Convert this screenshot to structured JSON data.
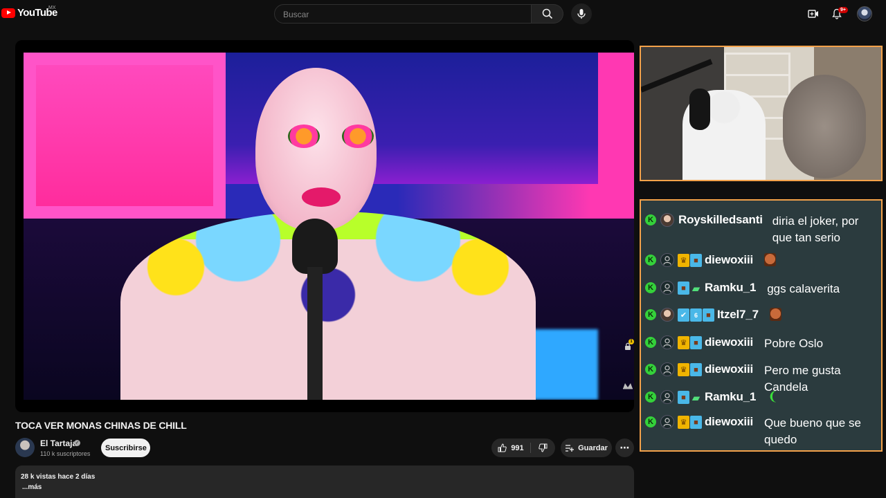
{
  "header": {
    "logo_text": "YouTube",
    "region": "MX",
    "search_placeholder": "Buscar",
    "notifications_count": "9+"
  },
  "player": {
    "controls": [
      "lock-icon",
      "theater-icon"
    ],
    "lock_badge": "1"
  },
  "chat": {
    "messages": [
      {
        "user": "Royskilledsanti",
        "badges": [],
        "text": "diria el joker, por que tan serio"
      },
      {
        "user": "diewoxiii",
        "badges": [
          "crown",
          "pic"
        ],
        "text": "",
        "emote": "face"
      },
      {
        "user": "Ramku_1",
        "badges": [
          "pic",
          "gift"
        ],
        "text": "ggs calaverita"
      },
      {
        "user": "Itzel7_7",
        "badges": [
          "tool",
          "num",
          "pic"
        ],
        "text": "",
        "emote": "face"
      },
      {
        "user": "diewoxiii",
        "badges": [
          "crown",
          "pic"
        ],
        "text": "Pobre Oslo"
      },
      {
        "user": "diewoxiii",
        "badges": [
          "crown",
          "pic"
        ],
        "text": "Pero me gusta Candela"
      },
      {
        "user": "Ramku_1",
        "badges": [
          "pic",
          "gift"
        ],
        "text": "",
        "emote": "pickle"
      },
      {
        "user": "diewoxiii",
        "badges": [
          "crown",
          "pic"
        ],
        "text": "Que bueno que se quedo"
      }
    ]
  },
  "video": {
    "title": "TOCA VER MONAS CHINAS DE CHILL",
    "channel": "El Tartaja",
    "subscribers": "110 k suscriptores",
    "subscribe_label": "Suscribirse",
    "likes": "991",
    "save_label": "Guardar",
    "more_label": "⋯",
    "stats": "28 k vistas  hace 2 días",
    "more_text": "...más"
  },
  "colors": {
    "accent": "#ff0000",
    "chat_bg": "#2b3b3e",
    "frame_border": "#f4a24a",
    "mod_badge": "#34d13a"
  }
}
